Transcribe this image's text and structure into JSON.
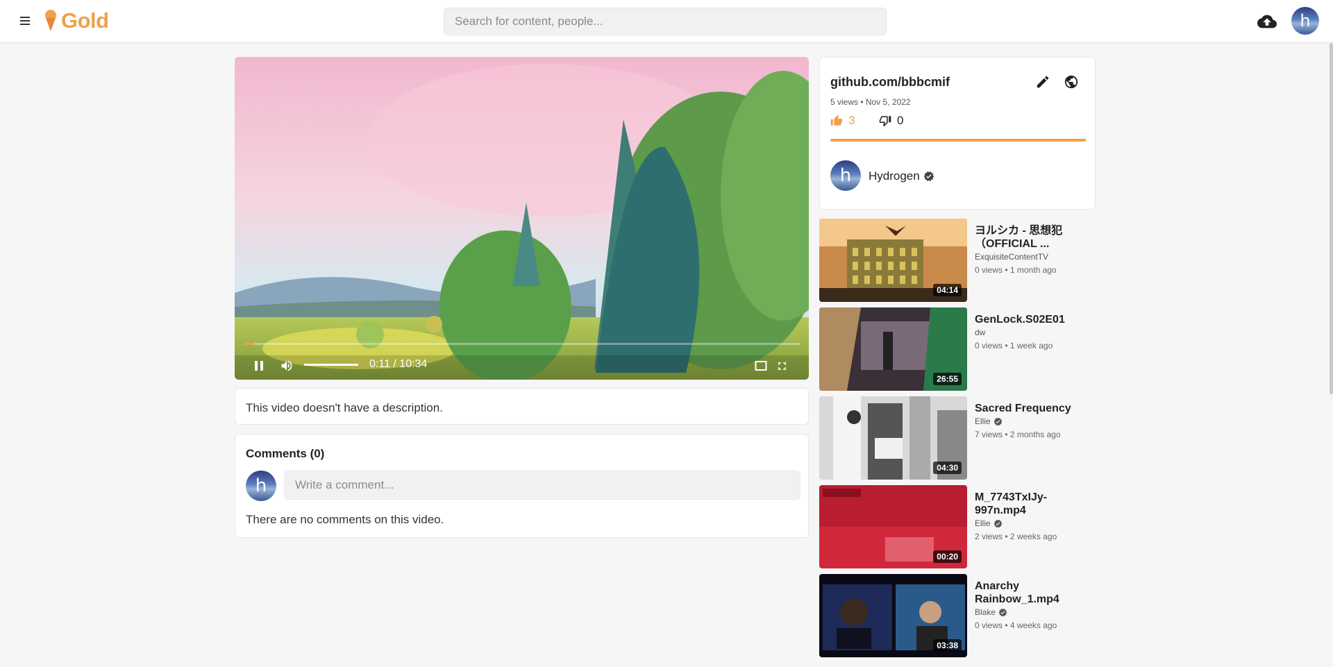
{
  "brand": {
    "name": "Gold",
    "accent": "#f0a04b"
  },
  "header": {
    "search_placeholder": "Search for content, people...",
    "avatar_letter": "h",
    "icons": [
      "menu-icon",
      "upload-icon"
    ]
  },
  "player": {
    "current_time": "0:11",
    "duration": "10:34",
    "time_display": "0:11 / 10:34",
    "progress_fraction": 0.017,
    "volume_fraction": 1.0,
    "icons": [
      "pause-icon",
      "volume-icon",
      "theater-icon",
      "fullscreen-icon"
    ]
  },
  "description": {
    "text": "This video doesn't have a description."
  },
  "comments": {
    "title": "Comments (0)",
    "input_placeholder": "Write a comment...",
    "empty_text": "There are no comments on this video.",
    "avatar_letter": "h"
  },
  "video_info": {
    "title": "github.com/bbbcmif",
    "meta": "5 views • Nov 5, 2022",
    "likes": "3",
    "dislikes": "0",
    "like_ratio": 1.0,
    "channel": {
      "name": "Hydrogen",
      "avatar_letter": "h",
      "verified": true
    }
  },
  "related": [
    {
      "title": "ヨルシカ - 思想犯（OFFICIAL ...",
      "author": "ExquisiteContentTV",
      "verified": false,
      "meta": "0 views • 1 month ago",
      "duration": "04:14"
    },
    {
      "title": "GenLock.S02E01",
      "author": "dw",
      "verified": false,
      "meta": "0 views • 1 week ago",
      "duration": "26:55"
    },
    {
      "title": "Sacred Frequency",
      "author": "Ellie",
      "verified": true,
      "meta": "7 views • 2 months ago",
      "duration": "04:30"
    },
    {
      "title": "M_7743TxIJy-997n.mp4",
      "author": "Ellie",
      "verified": true,
      "meta": "2 views • 2 weeks ago",
      "duration": "00:20"
    },
    {
      "title": "Anarchy Rainbow_1.mp4",
      "author": "Blake",
      "verified": true,
      "meta": "0 views • 4 weeks ago",
      "duration": "03:38"
    }
  ]
}
